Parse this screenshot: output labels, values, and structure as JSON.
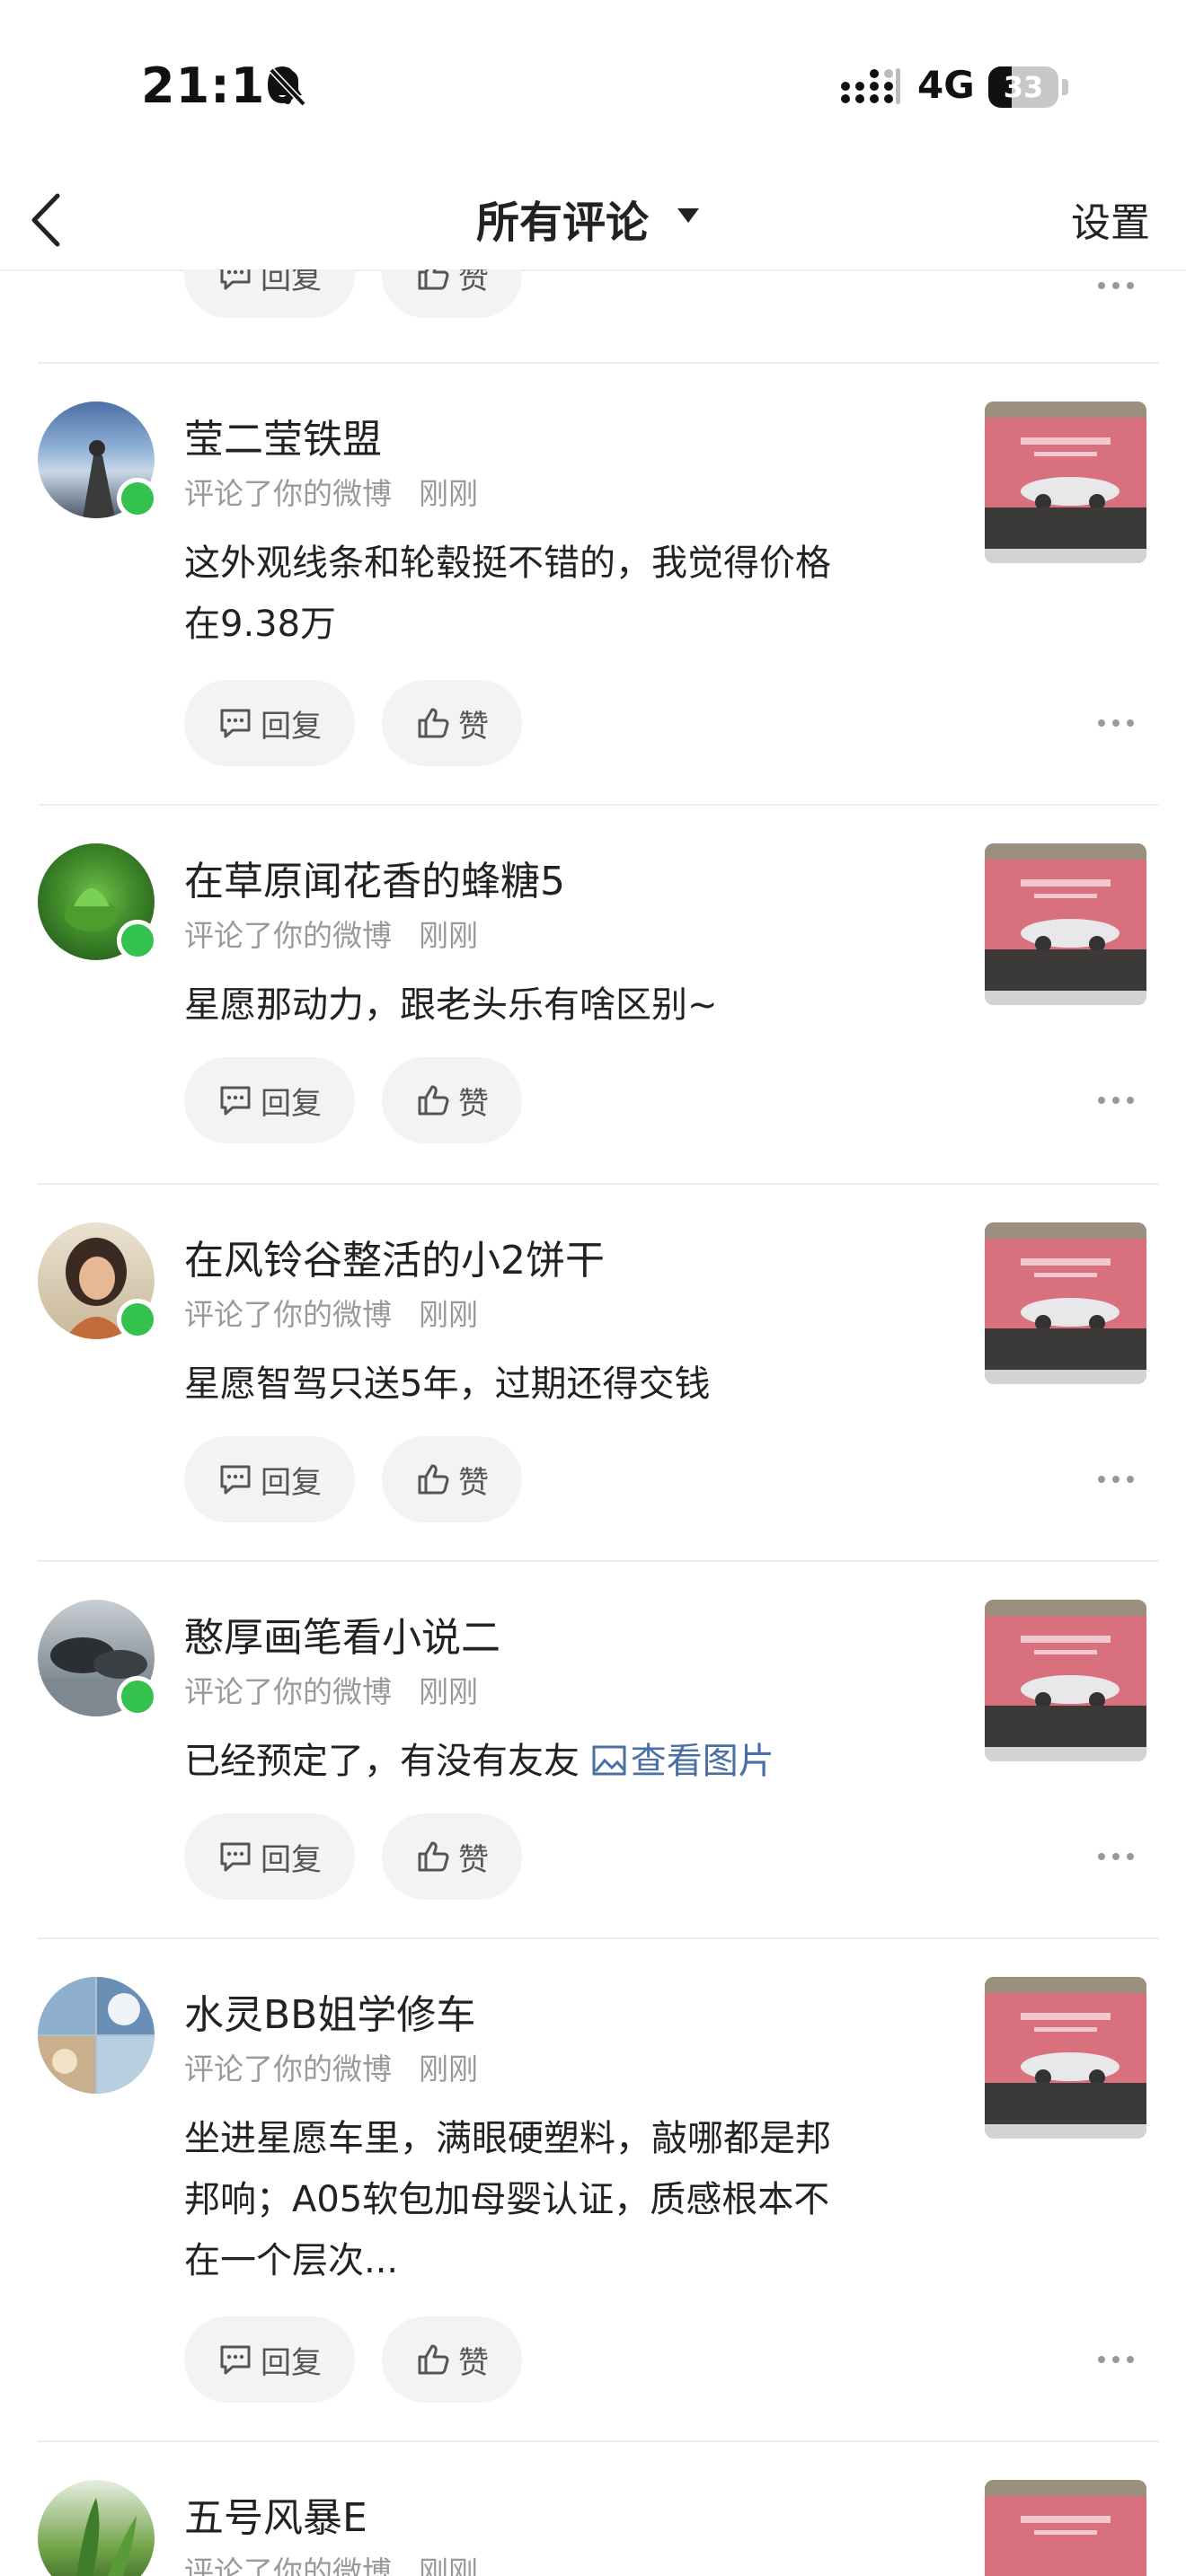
{
  "status_bar": {
    "time": "21:10",
    "network": "4G",
    "battery": "33",
    "battery_level": 0.33,
    "icons": [
      "bell-slash-icon",
      "signal-icon"
    ]
  },
  "nav": {
    "title": "所有评论",
    "settings": "设置",
    "icons": [
      "back-chevron-icon",
      "dropdown-caret-icon"
    ]
  },
  "actions": {
    "reply": "回复",
    "like": "赞"
  },
  "comments": [
    {
      "name": "莹二莹铁盟",
      "action": "评论了你的微博",
      "time": "刚刚",
      "text_lines": [
        "这外观线条和轮毂挺不错的，我觉得价格",
        "在9.38万"
      ],
      "online": true
    },
    {
      "name": "在草原闻花香的蜂糖5",
      "action": "评论了你的微博",
      "time": "刚刚",
      "text_lines": [
        "星愿那动力，跟老头乐有啥区别~"
      ],
      "online": true
    },
    {
      "name": "在风铃谷整活的小2饼干",
      "action": "评论了你的微博",
      "time": "刚刚",
      "text_lines": [
        "星愿智驾只送5年，过期还得交钱"
      ],
      "online": true
    },
    {
      "name": "憨厚画笔看小说二",
      "action": "评论了你的微博",
      "time": "刚刚",
      "text_lines": [
        "已经预定了，有没有友友 "
      ],
      "link": "查看图片",
      "online": true
    },
    {
      "name": "水灵BB姐学修车",
      "action": "评论了你的微博",
      "time": "刚刚",
      "text_lines": [
        "坐进星愿车里，满眼硬塑料，敲哪都是邦",
        "邦响；A05软包加母婴认证，质感根本不",
        "在一个层次..."
      ],
      "online": false
    },
    {
      "name": "五号风暴E",
      "action": "评论了你的微博",
      "time": "刚刚",
      "text_lines": [],
      "online": false
    }
  ]
}
